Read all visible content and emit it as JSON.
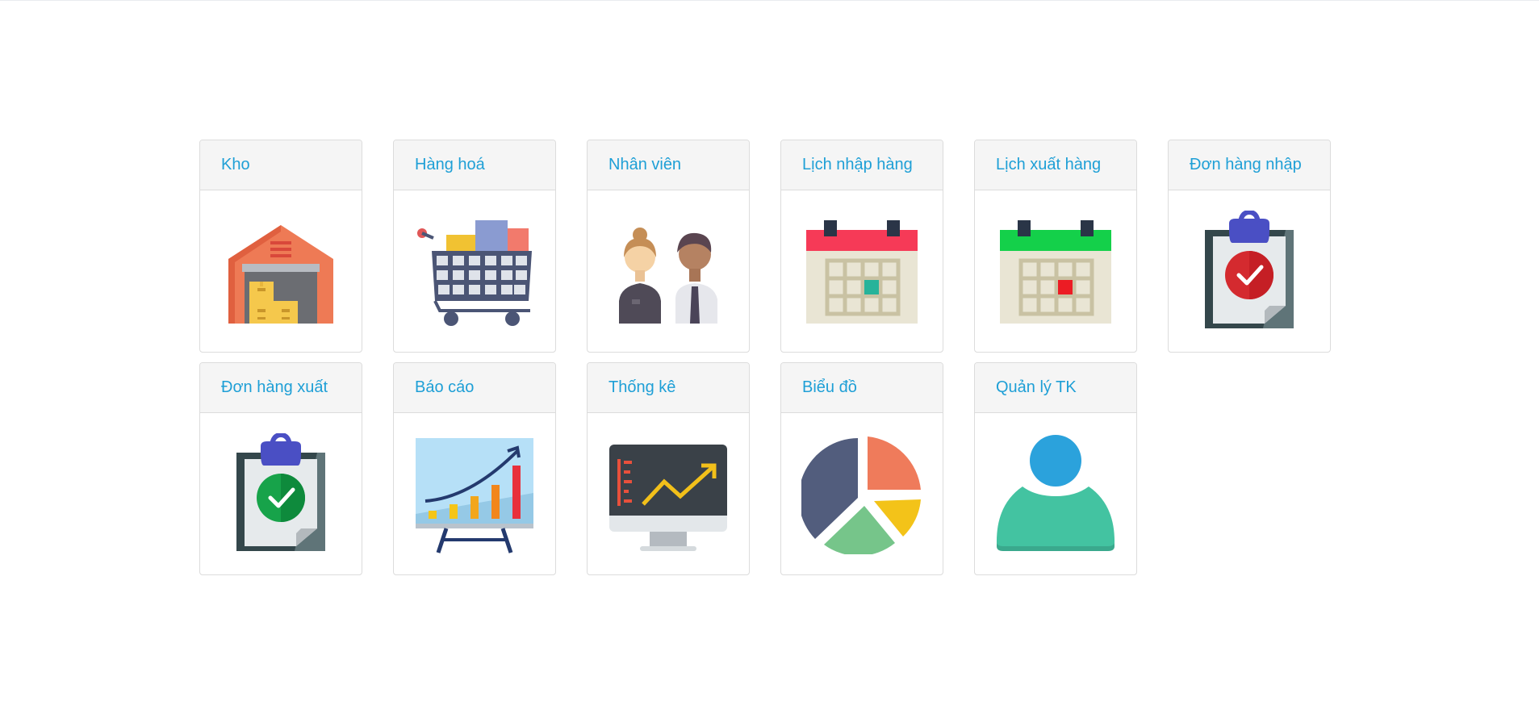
{
  "menu": {
    "items": [
      {
        "label": "Kho",
        "icon": "warehouse-icon"
      },
      {
        "label": "Hàng hoá",
        "icon": "shopping-cart-icon"
      },
      {
        "label": "Nhân viên",
        "icon": "staff-icon"
      },
      {
        "label": "Lịch nhập hàng",
        "icon": "calendar-import-icon"
      },
      {
        "label": "Lịch xuất hàng",
        "icon": "calendar-export-icon"
      },
      {
        "label": "Đơn hàng nhập",
        "icon": "clipboard-import-icon"
      },
      {
        "label": "Đơn hàng xuất",
        "icon": "clipboard-export-icon"
      },
      {
        "label": "Báo cáo",
        "icon": "report-chart-icon"
      },
      {
        "label": "Thống kê",
        "icon": "statistics-monitor-icon"
      },
      {
        "label": "Biểu đồ",
        "icon": "pie-chart-icon"
      },
      {
        "label": "Quản lý TK",
        "icon": "user-account-icon"
      }
    ]
  },
  "colors": {
    "link_text": "#1e9fd6",
    "header_bg": "#f5f5f5",
    "border": "#dcdcdc"
  }
}
